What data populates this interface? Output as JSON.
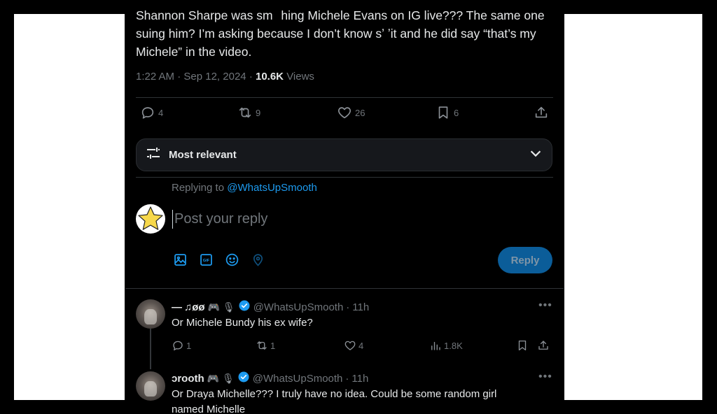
{
  "tweet": {
    "text": "Shannon Sharpe was sm   hing Michele Evans on IG live??? The same one suing him? I’m asking because I don’t know sʼ ʼit and he did say “that’s my Michele” in the video.",
    "time": "1:22 AM",
    "date": "Sep 12, 2024",
    "separator": "·",
    "views_count": "10.6K",
    "views_label": "Views",
    "actions": {
      "replies": "4",
      "reposts": "9",
      "likes": "26",
      "bookmarks": "6"
    }
  },
  "sort": {
    "label": "Most relevant"
  },
  "composer": {
    "replying_prefix": "Replying to",
    "replying_handle": "@WhatsUpSmooth",
    "placeholder": "Post your reply",
    "reply_button": "Reply"
  },
  "replies": [
    {
      "name": "— ♫øø",
      "emojis": "🎮 🎙",
      "handle": "@WhatsUpSmooth",
      "time": "11h",
      "text": "Or Michele Bundy his ex wife?",
      "replies": "1",
      "reposts": "1",
      "likes": "4",
      "views": "1.8K"
    },
    {
      "name": "ɔrooth",
      "emojis": "🎮 🎙",
      "handle": "@WhatsUpSmooth",
      "time": "11h",
      "text": "Or Draya Michelle??? I truly have no idea. Could be some random girl named Michelle"
    }
  ],
  "colors": {
    "accent": "#1d9bf0",
    "background": "#000000",
    "muted": "#71767b",
    "text": "#e7e9ea"
  }
}
